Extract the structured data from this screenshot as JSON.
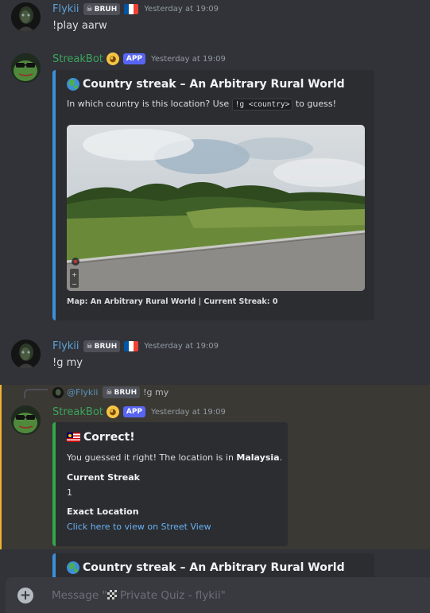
{
  "messages": [
    {
      "author": "Flykii",
      "tag": "BRUH",
      "timestamp": "Yesterday at 19:09",
      "text": "!play aarw"
    },
    {
      "author": "StreakBot",
      "badge": "APP",
      "timestamp": "Yesterday at 19:09",
      "embed": {
        "title": "Country streak – An Arbitrary Rural World",
        "desc_before": "In which country is this location? Use",
        "code": "!g <country>",
        "desc_after": "to guess!",
        "footer": "Map: An Arbitrary Rural World | Current Streak: 0"
      }
    },
    {
      "author": "Flykii",
      "tag": "BRUH",
      "timestamp": "Yesterday at 19:09",
      "text": "!g my"
    },
    {
      "reply": {
        "mention": "@Flykii",
        "tag": "BRUH",
        "text": "!g my"
      },
      "author": "StreakBot",
      "badge": "APP",
      "timestamp": "Yesterday at 19:09",
      "embed": {
        "title": "Correct!",
        "desc_before": "You guessed it right! The location is in",
        "country": "Malaysia",
        "desc_after": ".",
        "fields": [
          {
            "name": "Current Streak",
            "value": "1"
          },
          {
            "name": "Exact Location",
            "value": "Click here to view on Street View"
          }
        ]
      }
    },
    {
      "embed": {
        "title": "Country streak – An Arbitrary Rural World"
      }
    }
  ],
  "composer": {
    "placeholder_prefix": "Message \"",
    "placeholder_channel": "Private Quiz - flykii\""
  },
  "colors": {
    "background": "#313338",
    "embed_blue": "#3d8fd9",
    "embed_green": "#2fa84a",
    "bot_name": "#3ba55d",
    "user_name": "#5ea1d6",
    "app_badge": "#5865f2"
  },
  "icons": {
    "globe": "earth-globe-emoji",
    "malaysia_flag": "malaysia-flag-emoji",
    "france_flag": "france-flag-emoji",
    "skull": "skull-emoji",
    "bot_emoji": "smirk-face-emoji",
    "checkered_flag": "checkered-flag-emoji"
  }
}
